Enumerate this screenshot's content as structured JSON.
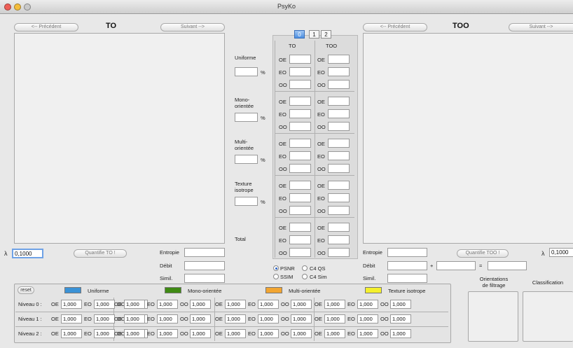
{
  "window": {
    "title": "PsyKo"
  },
  "left": {
    "prev": "<-- Précédent",
    "title": "TO",
    "next": "Suivant -->",
    "quantify": "Quantifie TO !",
    "lambda_symbol": "λ",
    "lambda_value": "0,1000"
  },
  "right": {
    "prev": "<-- Précédent",
    "title": "TOO",
    "next": "Suivant -->",
    "quantify": "Quantifie TOO !",
    "lambda_symbol": "λ",
    "lambda_value": "0,1000"
  },
  "metrics": {
    "entropie": "Entropie",
    "debit": "Débit",
    "simil": "Simil.",
    "plus": "+",
    "equals": "="
  },
  "center": {
    "tabs": [
      "0",
      "1",
      "2"
    ],
    "selected_tab": "0",
    "col_to": "TO",
    "col_too": "TOO",
    "rowlabels": [
      "OE",
      "EO",
      "OO"
    ],
    "percent": "%",
    "categories": [
      {
        "label": "Uniforme"
      },
      {
        "label": "Mono-\norientée"
      },
      {
        "label": "Multi-\norientée"
      },
      {
        "label": "Texture\nisotrope"
      },
      {
        "label": "Total"
      }
    ]
  },
  "radio": {
    "psnr": "PSNR",
    "ssim": "SSIM",
    "c4qs": "C4 QS",
    "c4sim": "C4 Sim",
    "selected": "PSNR"
  },
  "bottom": {
    "reset": "reset",
    "columns": [
      {
        "label": "Uniforme",
        "color": "#3a92d6"
      },
      {
        "label": "Mono-orientée",
        "color": "#3f8a14"
      },
      {
        "label": "Multi-orientée",
        "color": "#f2a531"
      },
      {
        "label": "Texture isotrope",
        "color": "#f4f02d"
      }
    ],
    "pairs": [
      "OE",
      "EO",
      "OO"
    ],
    "levels": [
      {
        "label": "Niveau 0 :"
      },
      {
        "label": "Niveau 1 :"
      },
      {
        "label": "Niveau 2 :"
      }
    ],
    "value": "1,000"
  },
  "side": {
    "orientations": "Orientations\nde filtrage",
    "classification": "Classification"
  }
}
